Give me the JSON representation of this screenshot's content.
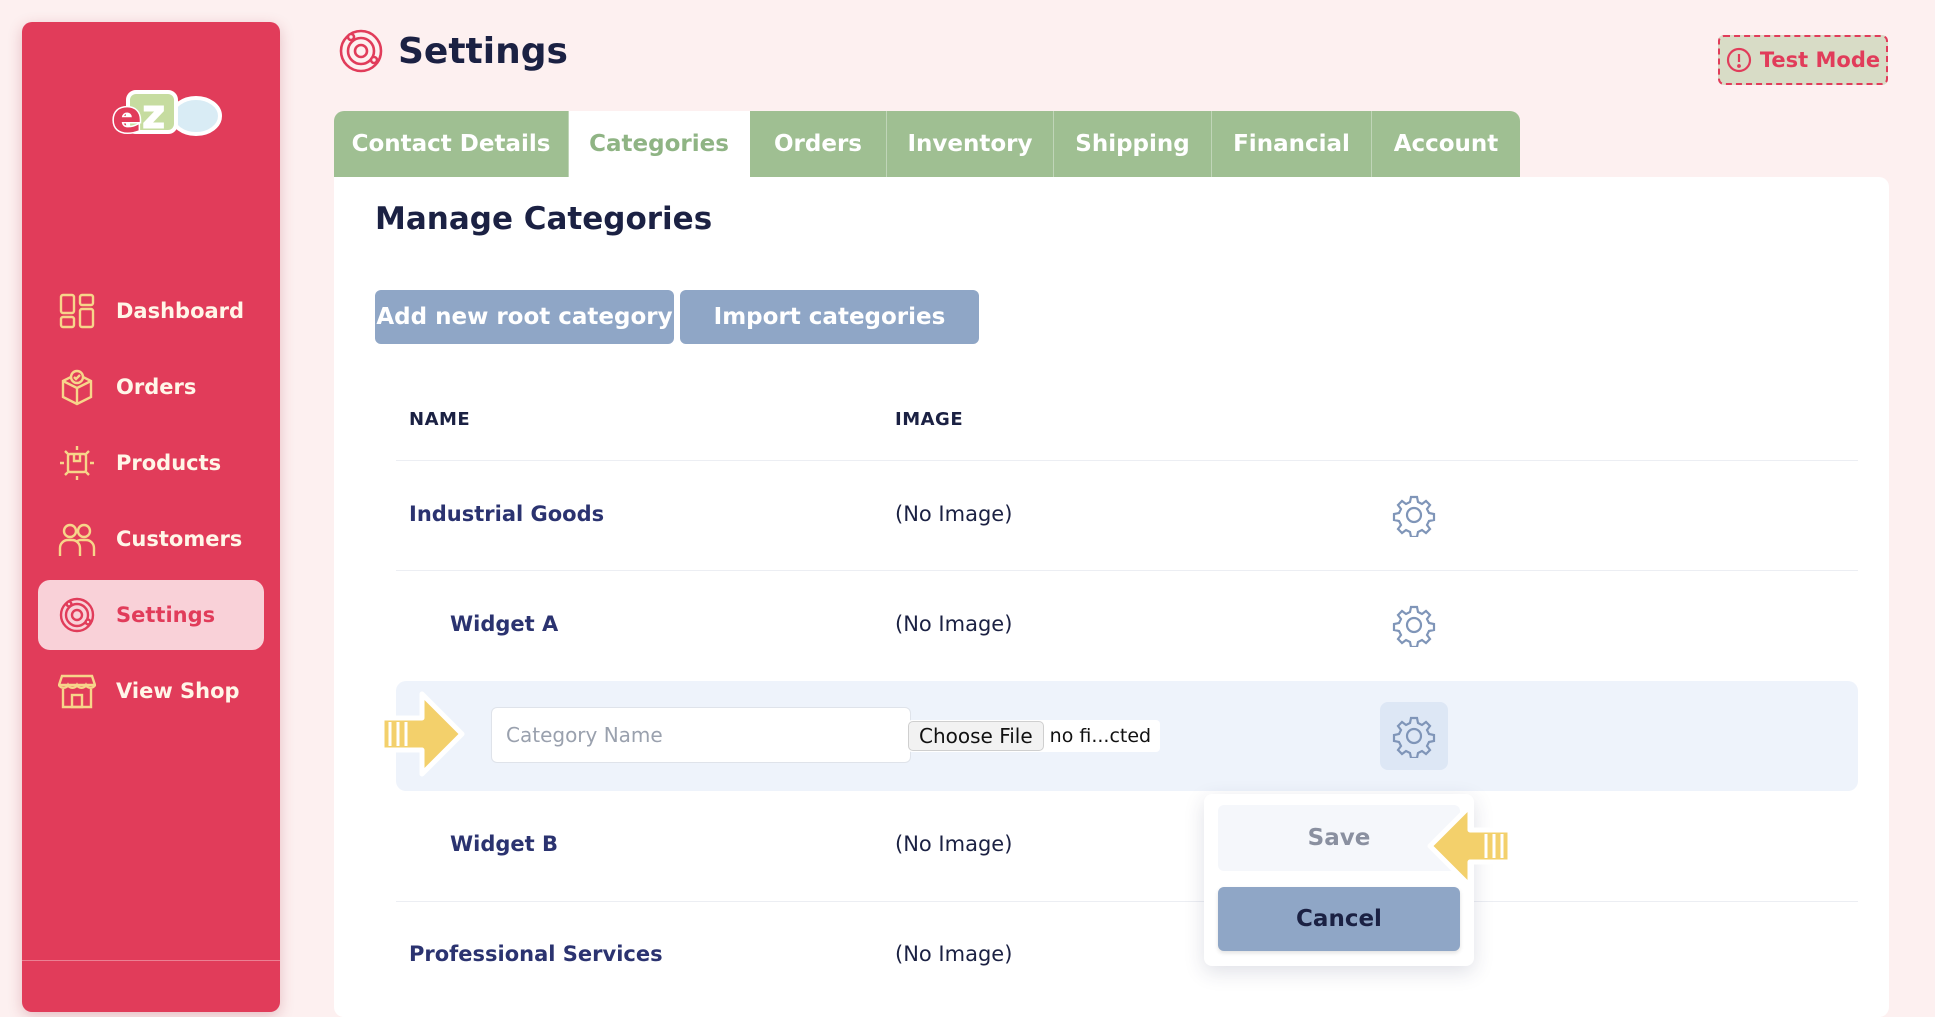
{
  "app": {
    "logo_text": "ezo"
  },
  "sidebar": {
    "items": [
      {
        "label": "Dashboard",
        "icon": "dashboard-icon"
      },
      {
        "label": "Orders",
        "icon": "orders-box-icon"
      },
      {
        "label": "Products",
        "icon": "products-box-icon"
      },
      {
        "label": "Customers",
        "icon": "customers-icon"
      },
      {
        "label": "Settings",
        "icon": "settings-gear-icon",
        "active": true
      },
      {
        "label": "View Shop",
        "icon": "shop-storefront-icon"
      }
    ]
  },
  "header": {
    "title": "Settings",
    "badge": "Test Mode"
  },
  "tabs": [
    {
      "label": "Contact Details"
    },
    {
      "label": "Categories",
      "active": true
    },
    {
      "label": "Orders"
    },
    {
      "label": "Inventory"
    },
    {
      "label": "Shipping"
    },
    {
      "label": "Financial"
    },
    {
      "label": "Account"
    }
  ],
  "main": {
    "section_title": "Manage Categories",
    "buttons": {
      "add_root": "Add new root category",
      "import": "Import categories"
    },
    "table": {
      "columns": [
        "NAME",
        "IMAGE"
      ],
      "rows": [
        {
          "name": "Industrial Goods",
          "image": "(No Image)"
        },
        {
          "name": "Widget A",
          "image": "(No Image)"
        },
        {
          "name": "Widget B",
          "image": "(No Image)"
        },
        {
          "name": "Professional Services",
          "image": "(No Image)"
        }
      ]
    },
    "edit_row": {
      "name_placeholder": "Category Name",
      "file_button": "Choose File",
      "file_status": "no fi...cted"
    },
    "popover": {
      "save": "Save",
      "cancel": "Cancel"
    }
  },
  "colors": {
    "sidebar": "#e13c5a",
    "tab_bar": "#9fbf92",
    "accent_blue": "#8fa6c6",
    "page_bg": "#fdf0f0",
    "arrow": "#f3d06b"
  }
}
